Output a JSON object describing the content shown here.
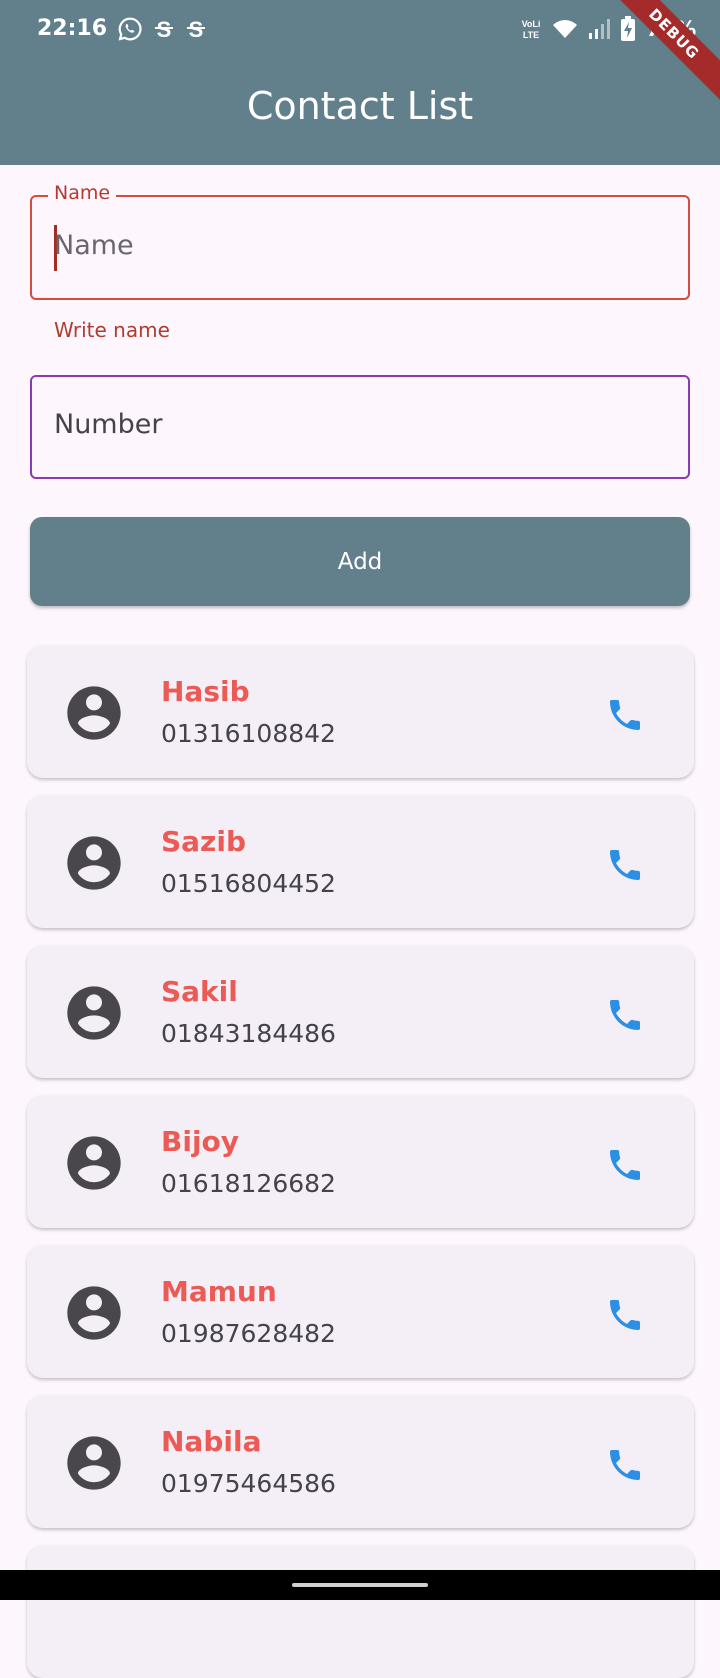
{
  "status_bar": {
    "time": "22:16",
    "left_icons": [
      "whatsapp-icon",
      "s-icon",
      "s-icon"
    ],
    "right_icons": [
      "volte-icon",
      "wifi-icon",
      "signal-icon",
      "battery-icon"
    ],
    "battery_text": "72%"
  },
  "debug_banner": "DEBUG",
  "app_bar": {
    "title": "Contact List"
  },
  "form": {
    "name_label": "Name",
    "name_placeholder": "Name",
    "name_helper": "Write name",
    "number_placeholder": "Number",
    "add_label": "Add"
  },
  "contacts": [
    {
      "name": "Hasib",
      "number": "01316108842"
    },
    {
      "name": "Sazib",
      "number": "01516804452"
    },
    {
      "name": "Sakil",
      "number": "01843184486"
    },
    {
      "name": "Bijoy",
      "number": "01618126682"
    },
    {
      "name": "Mamun",
      "number": "01987628482"
    },
    {
      "name": "Nabila",
      "number": "01975464586"
    }
  ],
  "colors": {
    "primary": "#62808c",
    "error": "#d64a3f",
    "name_text": "#ec5a55",
    "call_icon": "#2b8fe5",
    "card_bg": "#f4eff6"
  }
}
